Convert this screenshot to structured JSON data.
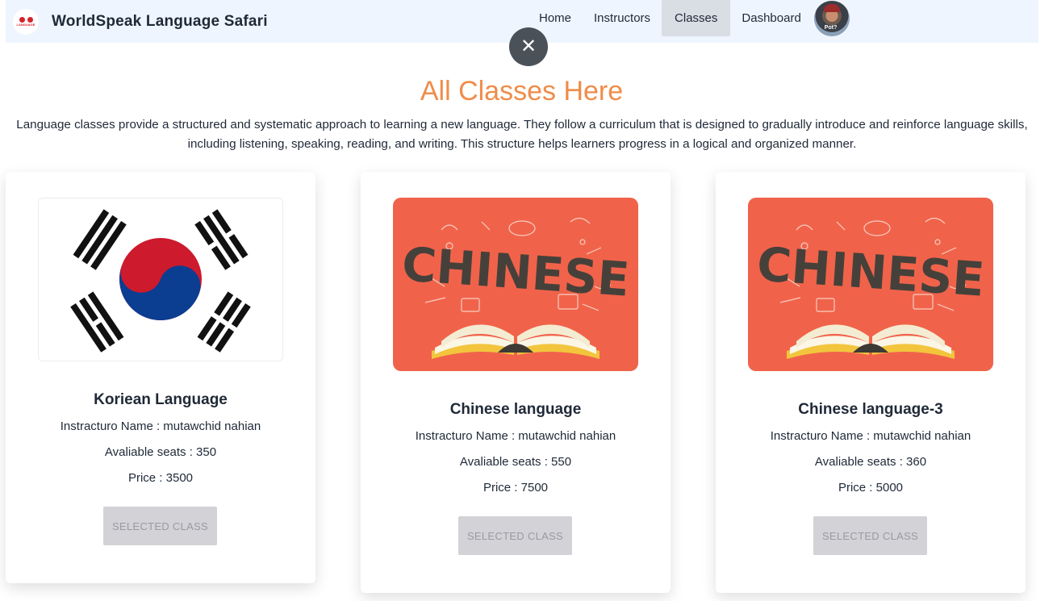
{
  "brand": {
    "name": "WorldSpeak Language Safari",
    "logo_text": "LANGUAGE"
  },
  "nav": {
    "items": [
      {
        "label": "Home"
      },
      {
        "label": "Instructors"
      },
      {
        "label": "Classes"
      },
      {
        "label": "Dashboard"
      }
    ],
    "active": "Classes",
    "avatar_text": "Pot?"
  },
  "close_symbol": "✕",
  "page": {
    "title": "All Classes Here",
    "intro": "Language classes provide a structured and systematic approach to learning a new language. They follow a curriculum that is designed to gradually introduce and reinforce language skills, including listening, speaking, reading, and writing. This structure helps learners progress in a logical and organized manner."
  },
  "classes": [
    {
      "title": "Koriean Language",
      "instructor": "Instracturo Name : mutawchid nahian",
      "seats": "Avaliable seats : 350",
      "price": "Price : 3500",
      "button": "SELECTED CLASS"
    },
    {
      "title": "Chinese language",
      "instructor": "Instracturo Name : mutawchid nahian",
      "seats": "Avaliable seats : 550",
      "price": "Price : 7500",
      "button": "SELECTED CLASS",
      "image_text": "CHINESE"
    },
    {
      "title": "Chinese language-3",
      "instructor": "Instracturo Name : mutawchid nahian",
      "seats": "Avaliable seats : 360",
      "price": "Price : 5000",
      "button": "SELECTED CLASS",
      "image_text": "CHINESE"
    }
  ],
  "colors": {
    "accent": "#ef8c49",
    "navbar_bg": "#eef5fe",
    "chinese_bg": "#f0634a",
    "flag_red": "#cd1a2d",
    "flag_blue": "#0b3d91",
    "button_disabled": "#d2d2d7"
  }
}
